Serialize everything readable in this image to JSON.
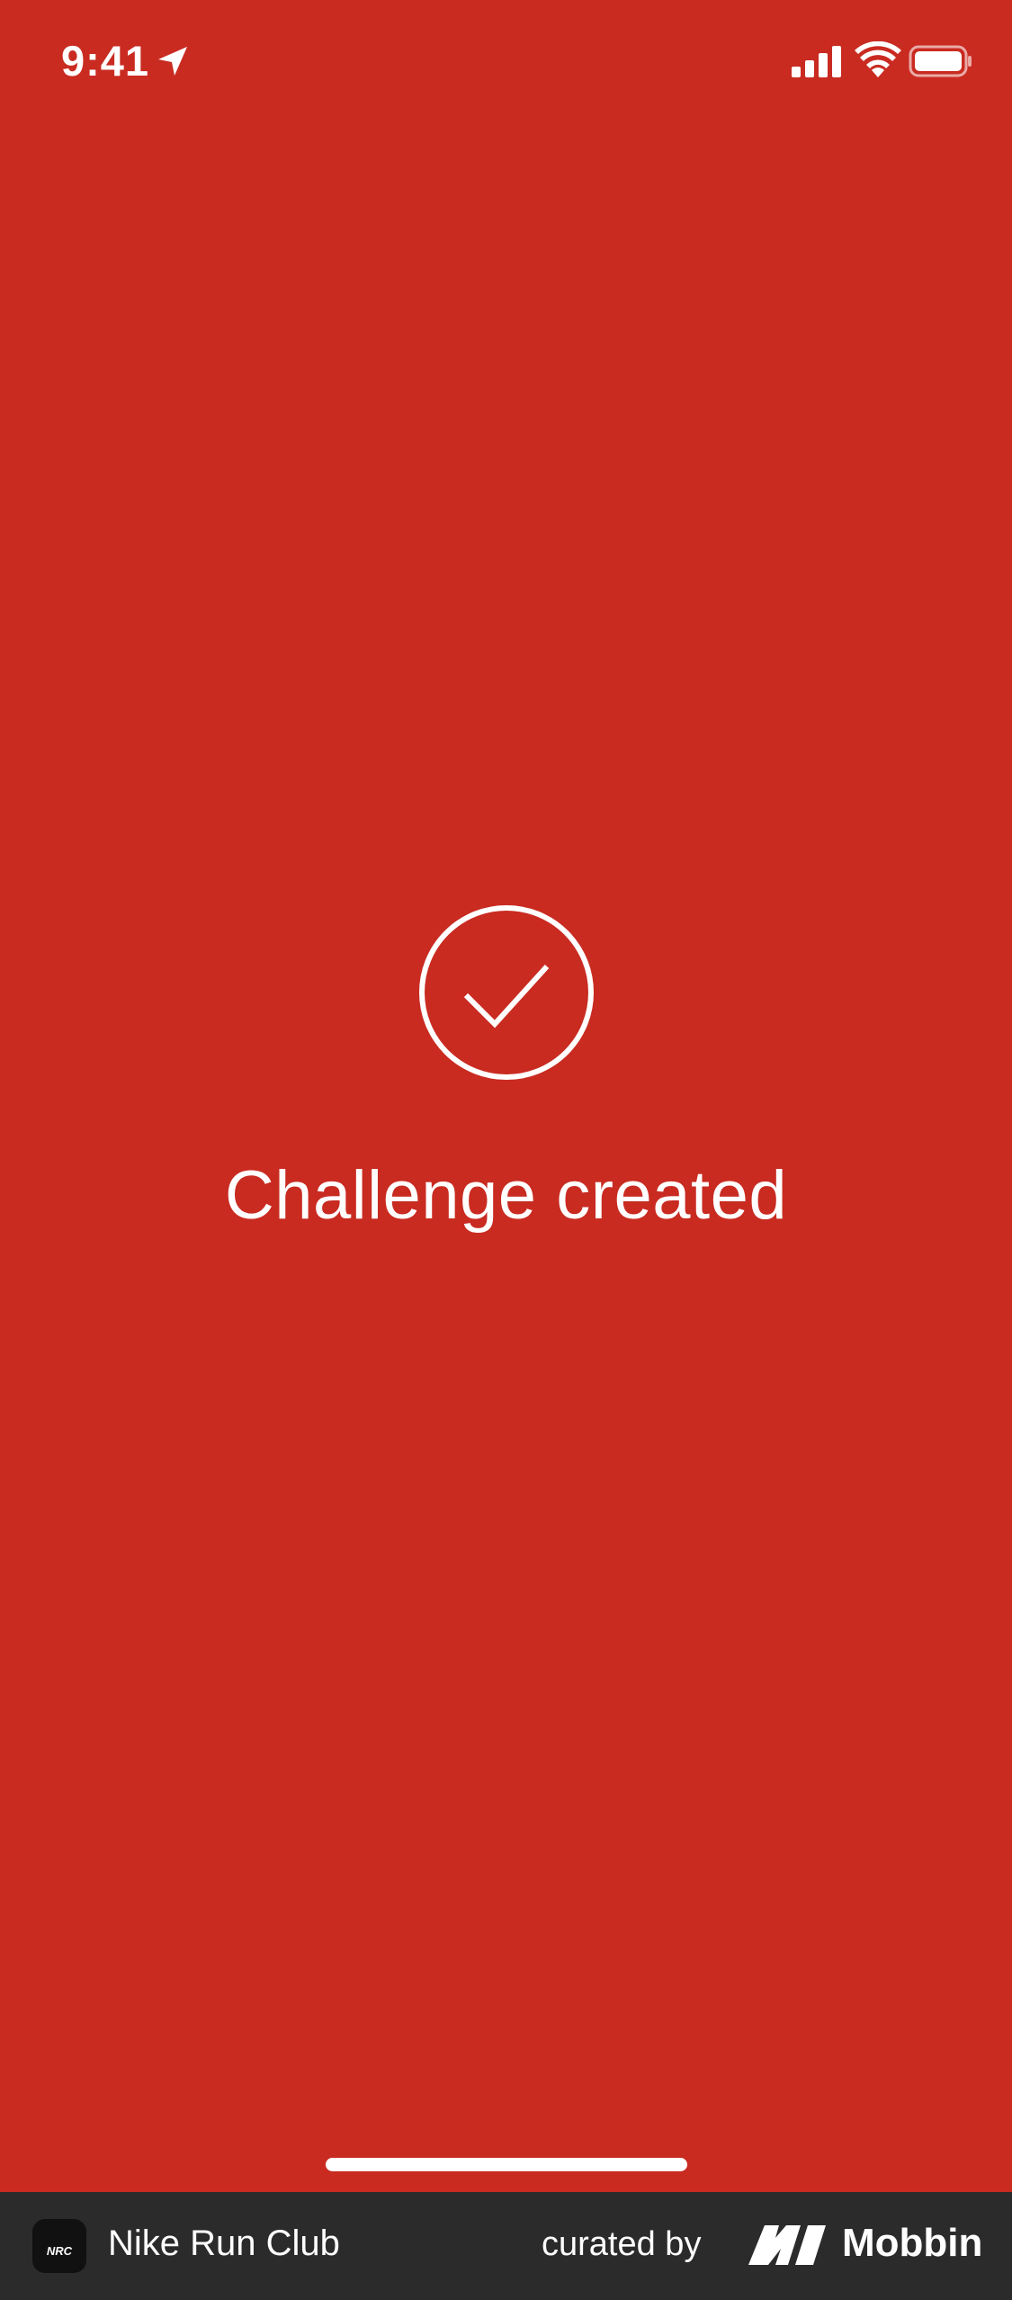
{
  "status_bar": {
    "time": "9:41",
    "icons": [
      "location-arrow-icon",
      "cellular-signal-icon",
      "wifi-icon",
      "battery-icon"
    ]
  },
  "confirmation": {
    "icon": "checkmark-circle-icon",
    "title": "Challenge created"
  },
  "footer": {
    "app_icon_text": "NRC",
    "app_name": "Nike Run Club",
    "curated_label": "curated by",
    "brand_name": "Mobbin"
  },
  "colors": {
    "background": "#C92B21",
    "foreground": "#FFFFFF",
    "footer_background": "#2B2B2B"
  }
}
